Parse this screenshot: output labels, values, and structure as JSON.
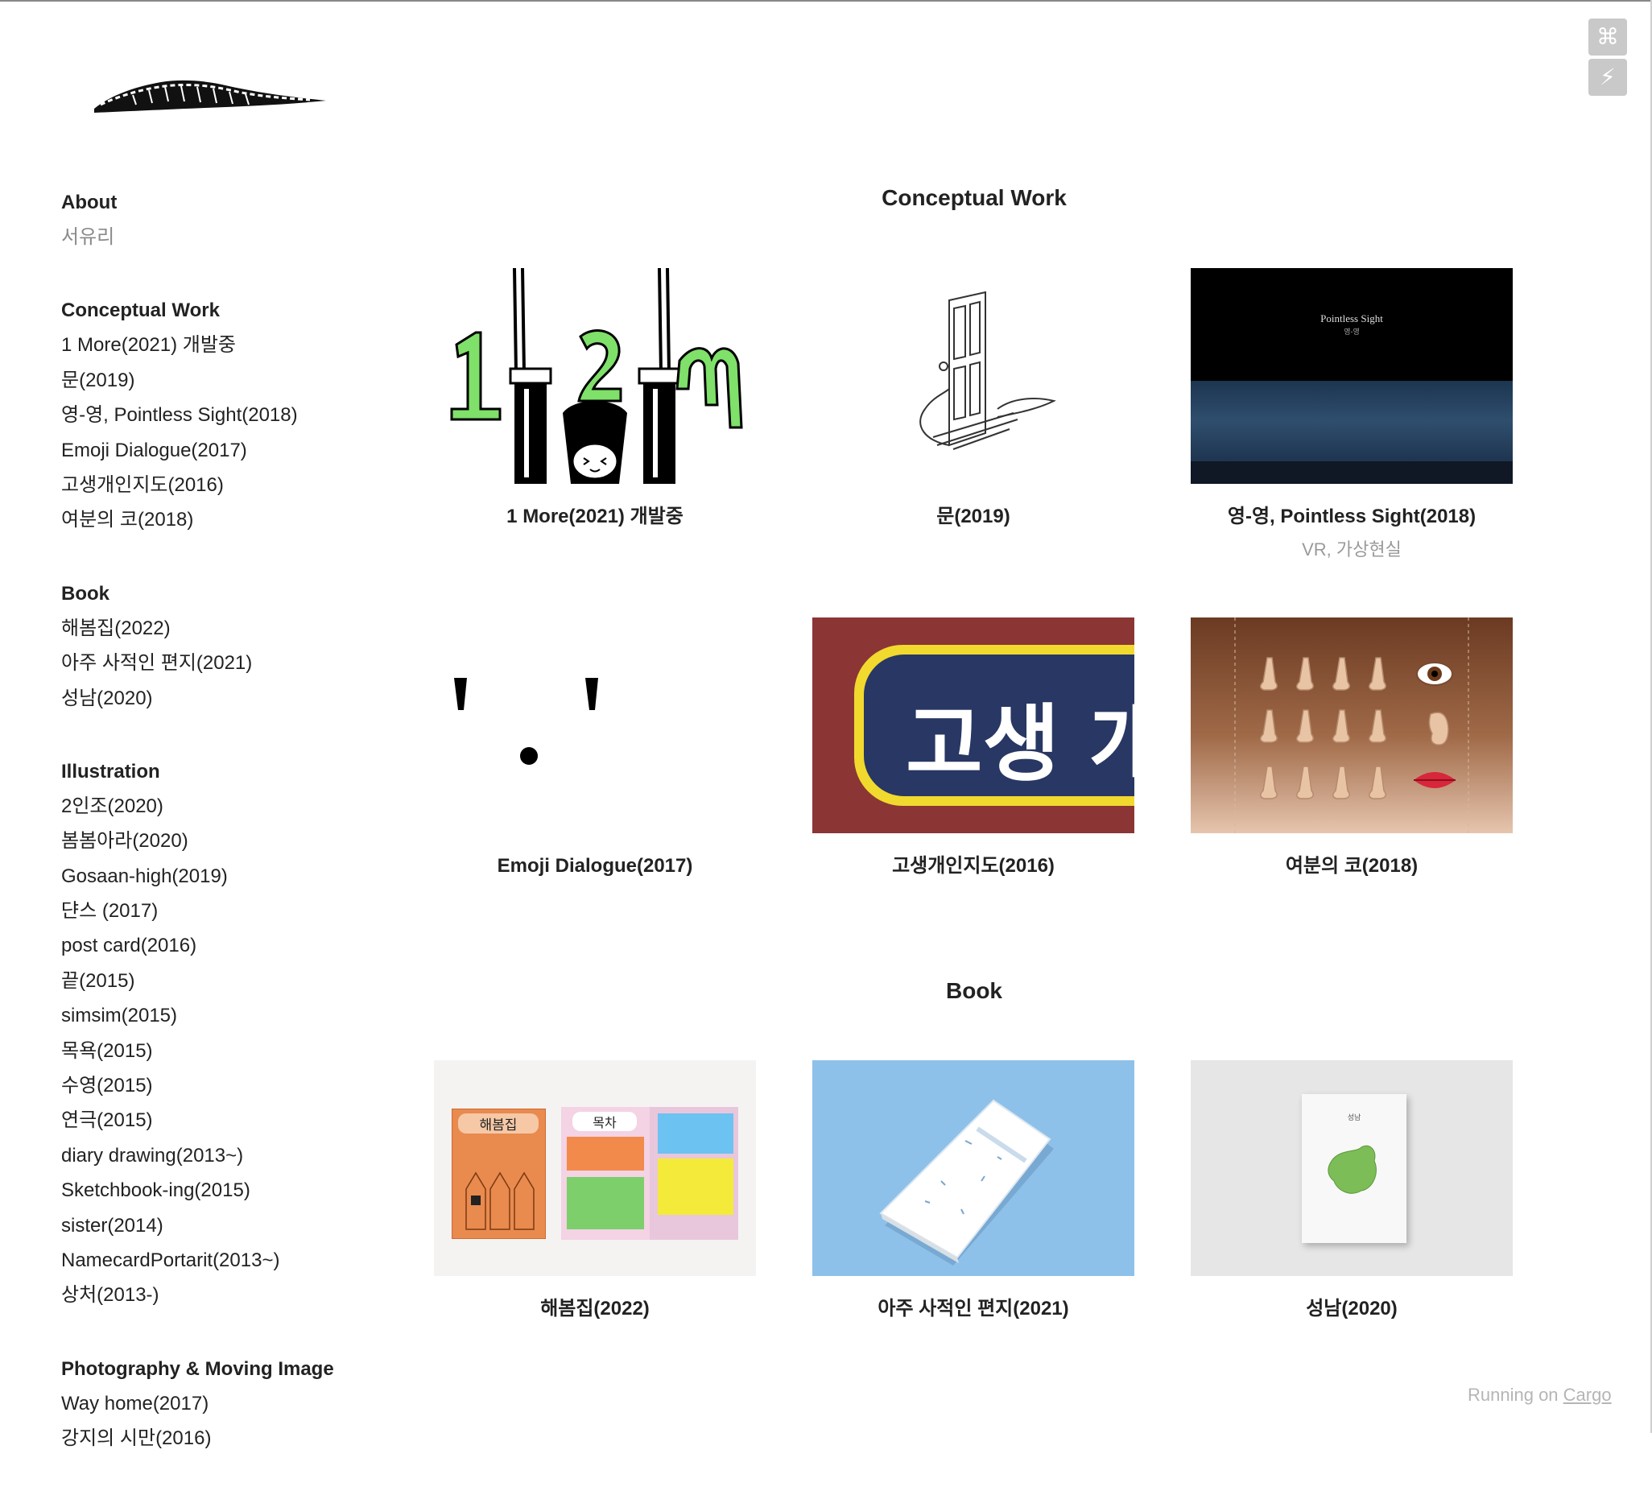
{
  "sidebar": {
    "sections": [
      {
        "title": "About",
        "items": [
          {
            "label": "서유리",
            "muted": true
          }
        ]
      },
      {
        "title": "Conceptual Work",
        "items": [
          {
            "label": "1 More(2021) 개발중"
          },
          {
            "label": "문(2019)"
          },
          {
            "label": "영-영, Pointless Sight(2018)"
          },
          {
            "label": "Emoji Dialogue(2017)"
          },
          {
            "label": "고생개인지도(2016)"
          },
          {
            "label": "여분의 코(2018)"
          }
        ]
      },
      {
        "title": "Book",
        "items": [
          {
            "label": "해봄집(2022)"
          },
          {
            "label": "아주 사적인 편지(2021)"
          },
          {
            "label": "성남(2020)"
          }
        ]
      },
      {
        "title": "Illustration",
        "items": [
          {
            "label": "2인조(2020)"
          },
          {
            "label": "봄봄아라(2020)"
          },
          {
            "label": "Gosaan-high(2019)"
          },
          {
            "label": "댠스 (2017)"
          },
          {
            "label": "post card(2016)"
          },
          {
            "label": "끝(2015)"
          },
          {
            "label": "simsim(2015)"
          },
          {
            "label": "목욕(2015)"
          },
          {
            "label": "수영(2015)"
          },
          {
            "label": "연극(2015)"
          },
          {
            "label": "diary drawing(2013~)"
          },
          {
            "label": "Sketchbook-ing(2015)"
          },
          {
            "label": "sister(2014)"
          },
          {
            "label": "NamecardPortarit(2013~)"
          },
          {
            "label": "상처(2013-)"
          }
        ]
      },
      {
        "title": "Photography & Moving Image",
        "items": [
          {
            "label": "Way home(2017)"
          },
          {
            "label": "강지의 시만(2016)"
          }
        ]
      }
    ]
  },
  "main": {
    "conceptual_heading": "Conceptual Work",
    "book_heading": "Book",
    "conceptual": [
      {
        "caption": "1 More(2021) 개발중",
        "thumb": "one-more"
      },
      {
        "caption": "문(2019)",
        "thumb": "door"
      },
      {
        "caption": "영-영, Pointless Sight(2018)",
        "sub": "VR, 가상현실",
        "thumb": "pointless-sight",
        "thumb_title": "Pointless Sight",
        "thumb_title_ko": "영-영"
      },
      {
        "caption": "Emoji Dialogue(2017)",
        "thumb": "emoji-face"
      },
      {
        "caption": "고생개인지도(2016)",
        "thumb": "gosaeng-sign",
        "thumb_text": "고생 개"
      },
      {
        "caption": "여분의 코(2018)",
        "thumb": "noses"
      }
    ],
    "books": [
      {
        "caption": "해봄집(2022)",
        "thumb": "haebom-book",
        "cover_title": "해봄집",
        "toc_title": "목차"
      },
      {
        "caption": "아주 사적인 편지(2021)",
        "thumb": "letter-book"
      },
      {
        "caption": "성남(2020)",
        "thumb": "seongnam-book",
        "cover_title": "성남"
      }
    ]
  },
  "toolbar": {
    "cmd_icon": "⌘",
    "bolt_icon": "⚡"
  },
  "footer": {
    "prefix": "Running on ",
    "link": "Cargo"
  }
}
